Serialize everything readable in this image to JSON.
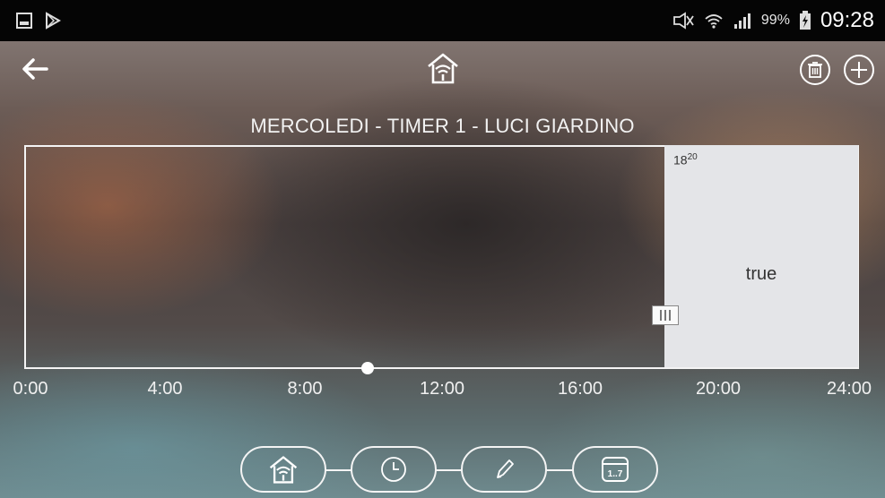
{
  "statusbar": {
    "icons": [
      "gallery-icon",
      "play-store-icon",
      "mute-icon",
      "wifi-icon",
      "signal-icon",
      "battery-charging-icon"
    ],
    "battery": "99%",
    "time": "09:28"
  },
  "topbar": {
    "icons": [
      "back-arrow-icon",
      "home-wifi-icon",
      "trash-icon",
      "plus-icon"
    ]
  },
  "title": "MERCOLEDI - TIMER 1 - LUCI GIARDINO",
  "timer_block": {
    "start_hour": "18",
    "start_minute": "20",
    "state": "true"
  },
  "timeline": {
    "ticks": [
      "0:00",
      "4:00",
      "8:00",
      "12:00",
      "16:00",
      "20:00",
      "24:00"
    ]
  },
  "bottom_nav": {
    "icons": [
      "home-wifi-icon",
      "clock-icon",
      "pencil-icon",
      "calendar-week-icon"
    ],
    "calendar_label": "1..7"
  },
  "colors": {
    "block": "#e4e5e8",
    "line": "#f4f4f4",
    "statusbar": "#050505"
  }
}
